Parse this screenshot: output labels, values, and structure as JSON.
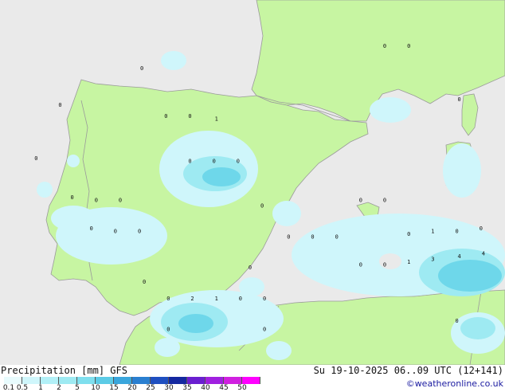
{
  "colors": {
    "sea": "#eaeaea",
    "land": "#c7f5a2",
    "border": "#9a9a9a",
    "precip_light": "#cff6fb",
    "precip_mid": "#9eeaf2",
    "precip_heavy": "#6ed7ea"
  },
  "map_labels": [
    {
      "text": "0",
      "value": 0,
      "lon": -5.6,
      "lat": 43.5
    },
    {
      "text": "0",
      "value": 0,
      "lon": -9.0,
      "lat": 42.2
    },
    {
      "text": "0",
      "value": 0,
      "lon": -10.0,
      "lat": 40.3
    },
    {
      "text": "0",
      "value": 0,
      "lon": -4.6,
      "lat": 41.8
    },
    {
      "text": "0",
      "value": 0,
      "lon": -3.6,
      "lat": 41.8
    },
    {
      "text": "1",
      "value": 1,
      "lon": -2.5,
      "lat": 41.7
    },
    {
      "text": "0",
      "value": 0,
      "lon": -3.6,
      "lat": 40.2
    },
    {
      "text": "0",
      "value": 0,
      "lon": -2.6,
      "lat": 40.2
    },
    {
      "text": "0",
      "value": 0,
      "lon": -1.6,
      "lat": 40.2
    },
    {
      "text": "0",
      "value": 0,
      "lon": -8.5,
      "lat": 38.9
    },
    {
      "text": "0",
      "value": 0,
      "lon": -7.5,
      "lat": 38.8
    },
    {
      "text": "0",
      "value": 0,
      "lon": -6.5,
      "lat": 38.8
    },
    {
      "text": "0",
      "value": 0,
      "lon": -7.7,
      "lat": 37.8
    },
    {
      "text": "0",
      "value": 0,
      "lon": -6.7,
      "lat": 37.7
    },
    {
      "text": "0",
      "value": 0,
      "lon": -5.7,
      "lat": 37.7
    },
    {
      "text": "0",
      "value": 0,
      "lon": -0.6,
      "lat": 38.6
    },
    {
      "text": "0",
      "value": 0,
      "lon": 0.5,
      "lat": 37.5
    },
    {
      "text": "0",
      "value": 0,
      "lon": 1.5,
      "lat": 37.5
    },
    {
      "text": "0",
      "value": 0,
      "lon": 2.5,
      "lat": 37.5
    },
    {
      "text": "0",
      "value": 0,
      "lon": 3.5,
      "lat": 38.8
    },
    {
      "text": "0",
      "value": 0,
      "lon": 4.5,
      "lat": 38.8
    },
    {
      "text": "0",
      "value": 0,
      "lon": 4.5,
      "lat": 44.3
    },
    {
      "text": "0",
      "value": 0,
      "lon": 5.5,
      "lat": 44.3
    },
    {
      "text": "0",
      "value": 0,
      "lon": 7.6,
      "lat": 42.4
    },
    {
      "text": "0",
      "value": 0,
      "lon": 5.5,
      "lat": 37.6
    },
    {
      "text": "1",
      "value": 1,
      "lon": 6.5,
      "lat": 37.7
    },
    {
      "text": "0",
      "value": 0,
      "lon": 7.5,
      "lat": 37.7
    },
    {
      "text": "0",
      "value": 0,
      "lon": 8.5,
      "lat": 37.8
    },
    {
      "text": "0",
      "value": 0,
      "lon": 3.5,
      "lat": 36.5
    },
    {
      "text": "0",
      "value": 0,
      "lon": 4.5,
      "lat": 36.5
    },
    {
      "text": "1",
      "value": 1,
      "lon": 5.5,
      "lat": 36.6
    },
    {
      "text": "3",
      "value": 3,
      "lon": 6.5,
      "lat": 36.7
    },
    {
      "text": "4",
      "value": 4,
      "lon": 7.6,
      "lat": 36.8
    },
    {
      "text": "4",
      "value": 4,
      "lon": 8.6,
      "lat": 36.9
    },
    {
      "text": "0",
      "value": 0,
      "lon": -1.1,
      "lat": 36.4
    },
    {
      "text": "0",
      "value": 0,
      "lon": -5.5,
      "lat": 35.9
    },
    {
      "text": "0",
      "value": 0,
      "lon": -4.5,
      "lat": 35.3
    },
    {
      "text": "2",
      "value": 2,
      "lon": -3.5,
      "lat": 35.3
    },
    {
      "text": "1",
      "value": 1,
      "lon": -2.5,
      "lat": 35.3
    },
    {
      "text": "0",
      "value": 0,
      "lon": -1.5,
      "lat": 35.3
    },
    {
      "text": "0",
      "value": 0,
      "lon": -0.5,
      "lat": 35.3
    },
    {
      "text": "0",
      "value": 0,
      "lon": -4.5,
      "lat": 34.2
    },
    {
      "text": "0",
      "value": 0,
      "lon": -0.5,
      "lat": 34.2
    },
    {
      "text": "0",
      "value": 0,
      "lon": 7.5,
      "lat": 34.5
    }
  ],
  "footer": {
    "title": "Precipitation [mm] GFS",
    "datetime": "Su 19-10-2025 06..09 UTC (12+141)",
    "credit": "©weatheronline.co.uk"
  },
  "legend": {
    "labels": [
      "0.1",
      "0.5",
      "1",
      "2",
      "5",
      "10",
      "15",
      "20",
      "25",
      "30",
      "35",
      "40",
      "45",
      "50"
    ],
    "colors": [
      "#e8fbfd",
      "#cff6fb",
      "#b2f0f7",
      "#9eeaf2",
      "#7fdfee",
      "#5ccbe6",
      "#3aa6dc",
      "#2a7fd0",
      "#1f4fc0",
      "#1428a0",
      "#6a1fd0",
      "#a020e0",
      "#d020e0",
      "#ff00ff"
    ]
  }
}
